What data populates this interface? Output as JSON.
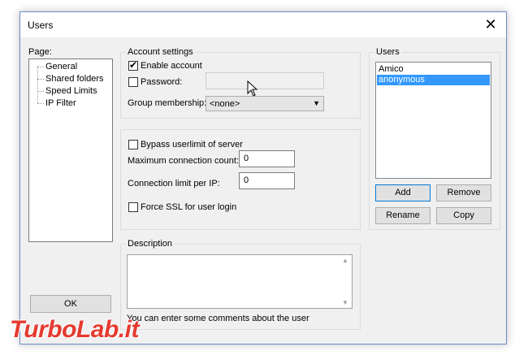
{
  "window": {
    "title": "Users",
    "close_glyph": "✕"
  },
  "page_panel": {
    "label": "Page:",
    "items": [
      "General",
      "Shared folders",
      "Speed Limits",
      "IP Filter"
    ],
    "ok_label": "OK"
  },
  "account": {
    "group_title": "Account settings",
    "enable_label": "Enable account",
    "enable_checked": true,
    "password_label": "Password:",
    "password_checked": false,
    "password_value": "",
    "group_label": "Group membership:",
    "group_value": "<none>"
  },
  "limits": {
    "bypass_label": "Bypass userlimit of server",
    "bypass_checked": false,
    "max_conn_label": "Maximum connection count:",
    "max_conn_value": "0",
    "per_ip_label": "Connection limit per IP:",
    "per_ip_value": "0",
    "force_ssl_label": "Force SSL for user login",
    "force_ssl_checked": false
  },
  "description": {
    "group_title": "Description",
    "value": "",
    "hint": "You can enter some comments about the user"
  },
  "users": {
    "group_title": "Users",
    "list": [
      {
        "name": "Amico",
        "selected": false
      },
      {
        "name": "anonymous",
        "selected": true
      }
    ],
    "add_label": "Add",
    "remove_label": "Remove",
    "rename_label": "Rename",
    "copy_label": "Copy"
  },
  "watermark": "TurboLab.it",
  "colors": {
    "selection": "#3399ff",
    "focus_border": "#0078d7",
    "watermark": "#e53a2f"
  }
}
